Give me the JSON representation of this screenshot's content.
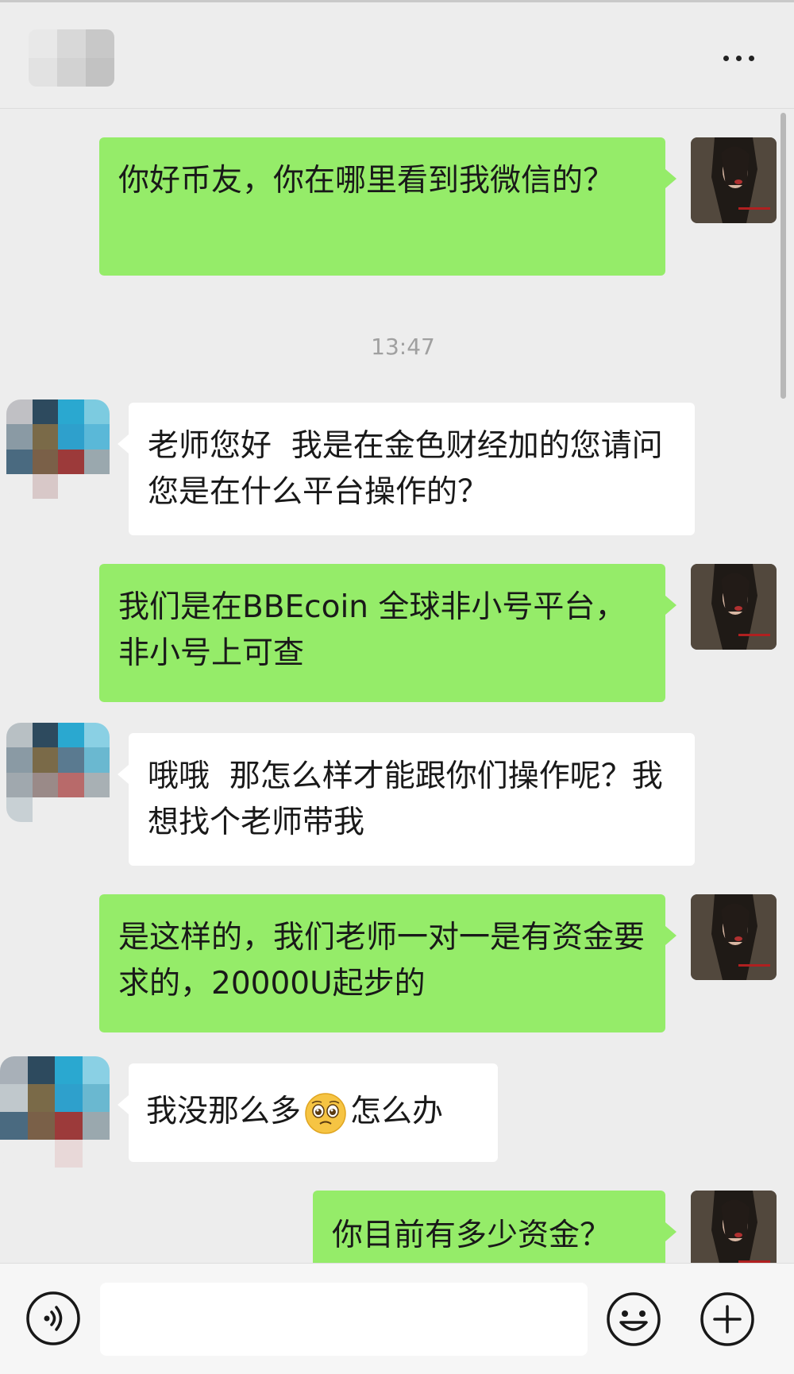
{
  "header": {
    "contact_name_redacted": true
  },
  "timestamp": "13:47",
  "messages": [
    {
      "side": "right",
      "text": "你好币友，你在哪里看到我微信的？"
    },
    {
      "side": "left",
      "text": "老师您好  我是在金色财经加的您请问您是在什么平台操作的？"
    },
    {
      "side": "right",
      "text": "我们是在BBEcoin 全球非小号平台，非小号上可查"
    },
    {
      "side": "left",
      "text": "哦哦  那怎么样才能跟你们操作呢？我想找个老师带我"
    },
    {
      "side": "right",
      "text": "是这样的，我们老师一对一是有资金要求的，20000U起步的"
    },
    {
      "side": "left",
      "text_before_emoji": "我没那么多",
      "emoji": "pleading-face-emoji",
      "text_after_emoji": "怎么办"
    },
    {
      "side": "right",
      "text": "你目前有多少资金？"
    }
  ],
  "input": {
    "value": "",
    "placeholder": ""
  },
  "icons": {
    "more": "more-dots-icon",
    "voice": "voice-icon",
    "emoji": "emoji-icon",
    "add": "plus-icon"
  },
  "colors": {
    "outgoing_bubble": "#95ec69",
    "incoming_bubble": "#ffffff",
    "background": "#ededed"
  }
}
